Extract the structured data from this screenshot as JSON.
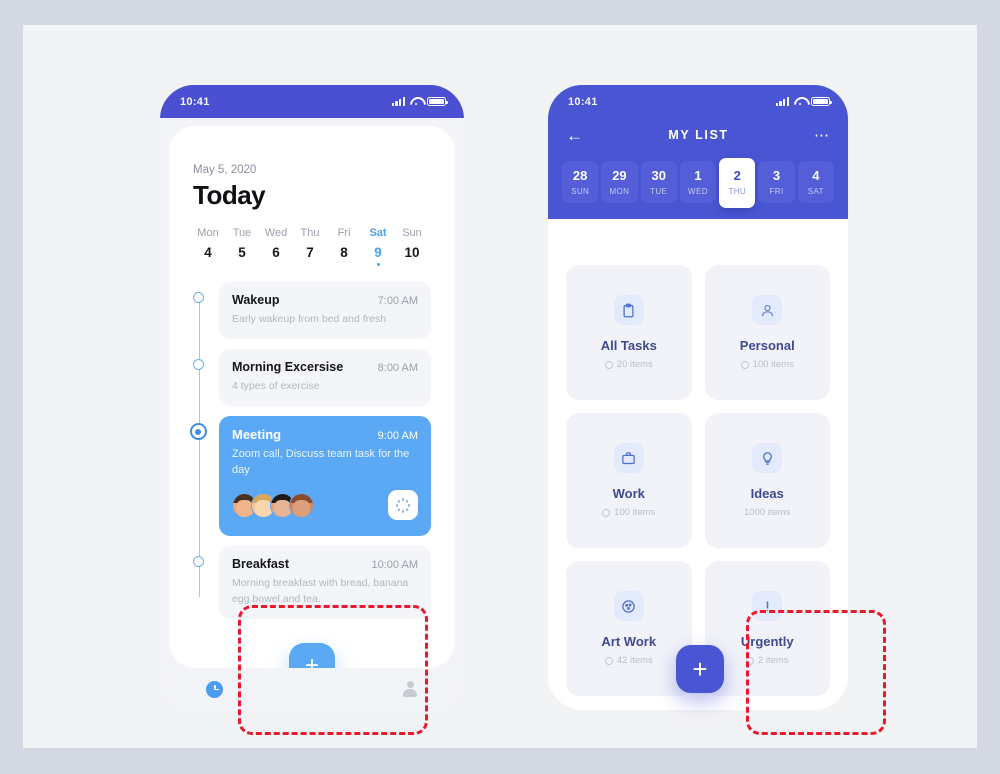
{
  "theme": {
    "page_bg": "#d4d9e4",
    "canvas_bg": "#f2f3f4",
    "left_accent": "#5ba9f5",
    "right_accent": "#4a55d4",
    "annotation_color": "#e8192c"
  },
  "left_phone": {
    "status_bar": {
      "time": "10:41",
      "signal_icon": "signal-bars-icon",
      "wifi_icon": "wifi-icon",
      "battery_icon": "battery-icon"
    },
    "date_label": "May 5, 2020",
    "title": "Today",
    "week": [
      {
        "name": "Mon",
        "num": "4",
        "active": false
      },
      {
        "name": "Tue",
        "num": "5",
        "active": false
      },
      {
        "name": "Wed",
        "num": "6",
        "active": false
      },
      {
        "name": "Thu",
        "num": "7",
        "active": false
      },
      {
        "name": "Fri",
        "num": "8",
        "active": false
      },
      {
        "name": "Sat",
        "num": "9",
        "active": true
      },
      {
        "name": "Sun",
        "num": "10",
        "active": false
      }
    ],
    "tasks": [
      {
        "title": "Wakeup",
        "time": "7:00 AM",
        "desc": "Early wakeup from bed and fresh",
        "highlight": false
      },
      {
        "title": "Morning Excersise",
        "time": "8:00 AM",
        "desc": "4 types of exercise",
        "highlight": false
      },
      {
        "title": "Meeting",
        "time": "9:00 AM",
        "desc": "Zoom call, Discuss team task for the day",
        "highlight": true
      },
      {
        "title": "Breakfast",
        "time": "10:00 AM",
        "desc": "Morning breakfast with bread, banana egg bowel and tea.",
        "highlight": false
      }
    ],
    "meeting_attendees": 4,
    "meeting_action_icon": "loading-spinner-icon",
    "fab_label": "+",
    "bottom_nav": [
      {
        "icon": "clock-icon",
        "active": true
      },
      {
        "icon": "person-icon",
        "active": false
      }
    ]
  },
  "right_phone": {
    "status_bar": {
      "time": "10:41",
      "signal_icon": "signal-bars-icon",
      "wifi_icon": "wifi-icon",
      "battery_icon": "battery-icon"
    },
    "back_icon": "back-arrow-icon",
    "title": "MY LIST",
    "menu_icon": "more-options-icon",
    "dates": [
      {
        "num": "28",
        "day": "SUN",
        "selected": false
      },
      {
        "num": "29",
        "day": "MON",
        "selected": false
      },
      {
        "num": "30",
        "day": "TUE",
        "selected": false
      },
      {
        "num": "1",
        "day": "WED",
        "selected": false
      },
      {
        "num": "2",
        "day": "THU",
        "selected": true
      },
      {
        "num": "3",
        "day": "FRI",
        "selected": false
      },
      {
        "num": "4",
        "day": "SAT",
        "selected": false
      }
    ],
    "categories": [
      {
        "name": "All Tasks",
        "count": "20 items",
        "icon": "clipboard-icon"
      },
      {
        "name": "Personal",
        "count": "100 items",
        "icon": "person-icon"
      },
      {
        "name": "Work",
        "count": "100 items",
        "icon": "briefcase-icon"
      },
      {
        "name": "Ideas",
        "count": "1000 items",
        "icon": "lightbulb-icon"
      },
      {
        "name": "Art Work",
        "count": "42 items",
        "icon": "palette-icon"
      },
      {
        "name": "Urgently",
        "count": "2 items",
        "icon": "exclamation-icon"
      }
    ],
    "fab_label": "+"
  }
}
